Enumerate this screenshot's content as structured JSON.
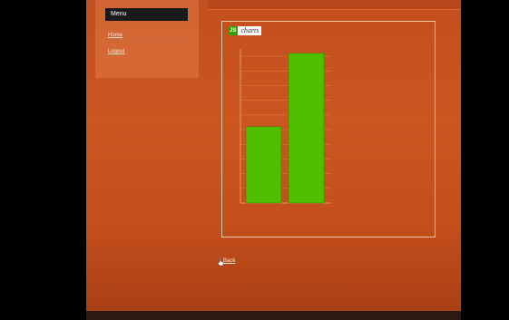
{
  "sidebar": {
    "menu_title": "Menu",
    "links": [
      "Home",
      "Logout"
    ]
  },
  "chart_logo": {
    "badge": "JS",
    "word": "charts"
  },
  "actions": {
    "back": "Back"
  },
  "chart_data": {
    "type": "bar",
    "title": "",
    "categories": [
      "",
      ""
    ],
    "values": [
      5.2,
      10.2
    ],
    "ylim": [
      0,
      10.5
    ],
    "xlabel": "",
    "ylabel": "",
    "bar_color": "#4fc000",
    "grid_color": "#e8b45c",
    "text_color": "#ffd866"
  },
  "colors": {
    "page_bg": "#cc5620",
    "outer_bg": "#000000",
    "menu_header_bg": "#1a1a1a"
  }
}
